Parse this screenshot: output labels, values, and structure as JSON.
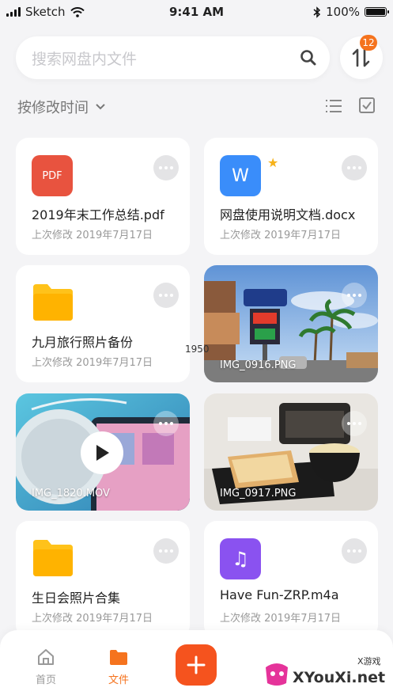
{
  "status_bar": {
    "carrier": "Sketch",
    "time": "9:41 AM",
    "battery": "100%"
  },
  "search": {
    "placeholder": "搜索网盘内文件"
  },
  "sort_badge": "12",
  "filter": {
    "label": "按修改时间"
  },
  "files": [
    {
      "name": "2019年末工作总结.pdf",
      "date": "上次修改 2019年7月17日",
      "icon_text": "PDF",
      "icon": "pdf-icon"
    },
    {
      "name": "网盘使用说明文档.docx",
      "date": "上次修改 2019年7月17日",
      "icon_text": "W",
      "icon": "word-icon"
    },
    {
      "name": "九月旅行照片备份",
      "date": "上次修改 2019年7月17日",
      "icon": "folder-icon"
    },
    {
      "name": "IMG_0916.PNG",
      "icon": "image-thumbnail"
    },
    {
      "name": "IMG_1820.MOV",
      "icon": "video-thumbnail"
    },
    {
      "name": "IMG_0917.PNG",
      "icon": "image-thumbnail"
    },
    {
      "name": "生日会照片合集",
      "date": "上次修改 2019年7月17日",
      "icon": "folder-icon"
    },
    {
      "name": "Have Fun-ZRP.m4a",
      "date": "上次修改 2019年7月17日",
      "icon": "music-icon"
    }
  ],
  "stray_label": "1950",
  "tabbar": {
    "home": "首页",
    "files": "文件"
  },
  "watermark": {
    "text": "XYouXi.net",
    "small": "X游戏"
  },
  "colors": {
    "accent": "#f5731e",
    "add_button": "#f5531e",
    "pdf": "#e8533f",
    "word": "#3a8dfa",
    "music": "#8a52f0",
    "folder": "#ffc21a"
  }
}
